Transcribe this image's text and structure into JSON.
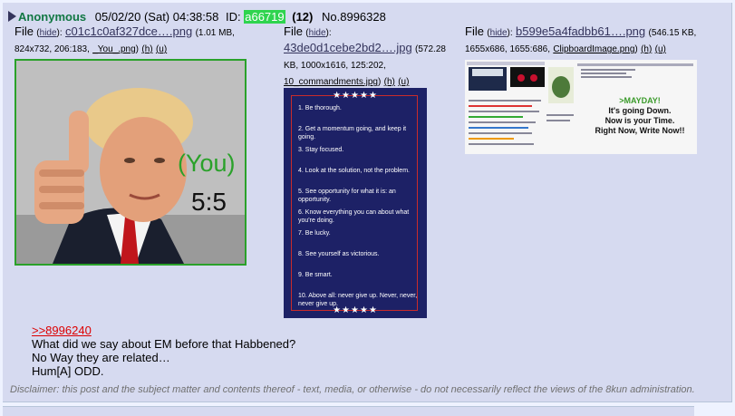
{
  "post": {
    "name": "Anonymous",
    "date": "05/02/20 (Sat) 04:38:58",
    "id_label": "ID:",
    "id_value": "a66719",
    "reply_count": "(12)",
    "post_number": "No.8996328"
  },
  "files": [
    {
      "label": "File",
      "hide": "hide",
      "filename": "c01c1c0af327dce….png",
      "meta": "(1.01 MB, 824x732, 206:183,",
      "orig": "_You_.png",
      "h": "(h)",
      "u": "(u)"
    },
    {
      "label": "File",
      "hide": "hide",
      "filename": "43de0d1cebe2bd2….jpg",
      "meta": "(572.28 KB, 1000x1616, 125:202,",
      "orig": "10_commandments.jpg",
      "h": "(h)",
      "u": "(u)"
    },
    {
      "label": "File",
      "hide": "hide",
      "filename": "b599e5a4fadbb61….png",
      "meta": "(546.15 KB, 1655x686, 1655:686,",
      "orig": "ClipboardImage.png",
      "h": "(h)",
      "u": "(u)"
    }
  ],
  "thumb1": {
    "line1": "(You)",
    "line2": "5:5"
  },
  "thumb2": {
    "stars": "★★★★★",
    "items": [
      "1. Be thorough.",
      "2. Get a momentum going, and keep it going.",
      "3. Stay focused.",
      "4. Look at the solution, not the problem.",
      "5. See opportunity for what it is: an opportunity.",
      "6. Know everything you can about what you're doing.",
      "7. Be lucky.",
      "8. See yourself as victorious.",
      "9. Be smart.",
      "10. Above all: never give up. Never, never, never give up."
    ]
  },
  "thumb3": {
    "mayday": ">MAYDAY!",
    "l1": "It's going Down.",
    "l2": "Now is your Time.",
    "l3": "Right Now, Write Now!!"
  },
  "body": {
    "quote_link": ">>8996240",
    "lines": [
      "What did we say about EM before that Habbened?",
      "No Way they are related…",
      "Hum[A] ODD."
    ]
  },
  "disclaimer": "Disclaimer: this post and the subject matter and contents thereof - text, media, or otherwise - do not necessarily reflect the views of the 8kun administration.",
  "colors": {
    "name": "#117743",
    "id_bg": "#2fd44f",
    "link": "#34345c",
    "quote": "#dd0000",
    "post_bg": "#d6daf0"
  }
}
